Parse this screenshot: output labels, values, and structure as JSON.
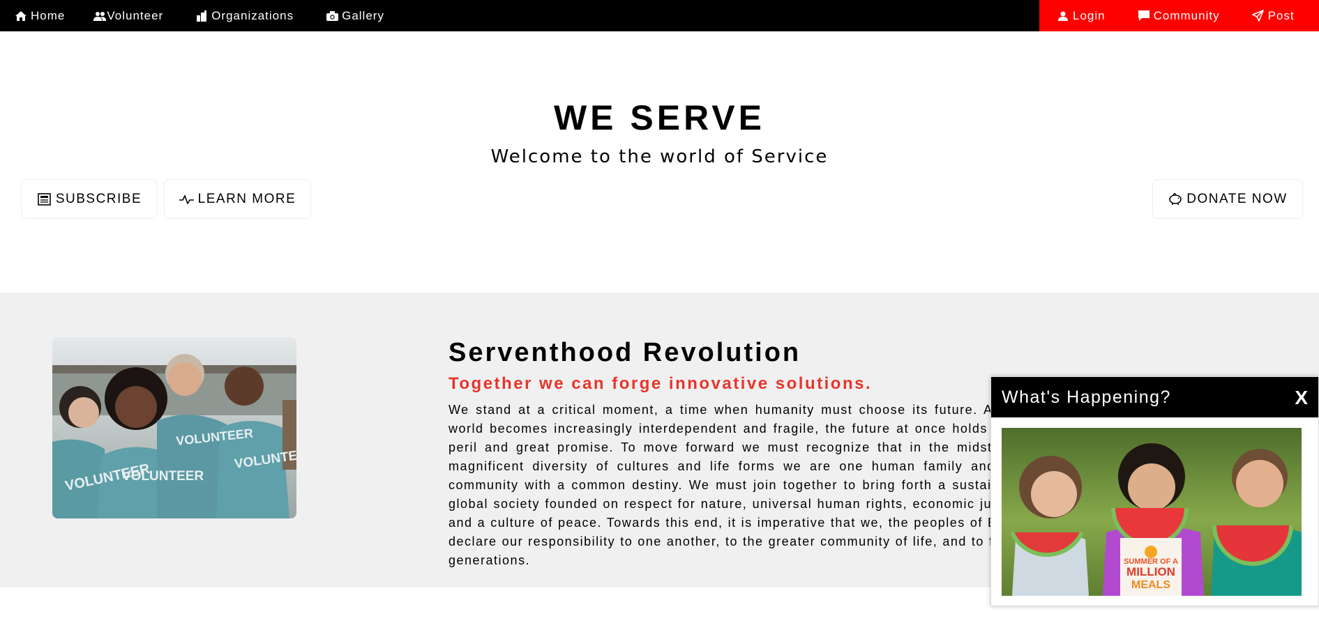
{
  "nav": {
    "left": [
      {
        "label": "Home",
        "icon": "home-icon"
      },
      {
        "label": "Volunteer",
        "icon": "users-icon"
      },
      {
        "label": "Organizations",
        "icon": "building-icon"
      },
      {
        "label": "Gallery",
        "icon": "camera-icon"
      }
    ],
    "right": [
      {
        "label": "Login",
        "icon": "user-icon"
      },
      {
        "label": "Community",
        "icon": "chat-icon"
      },
      {
        "label": "Post",
        "icon": "send-icon"
      }
    ],
    "accent": "#ff0000"
  },
  "hero": {
    "title": "WE SERVE",
    "subtitle": "Welcome to the world of Service",
    "subscribe": "SUBSCRIBE",
    "learn_more": "LEARN MORE",
    "donate": "DONATE NOW"
  },
  "section": {
    "title": "Serventhood Revolution",
    "subtitle": "Together we can forge innovative solutions.",
    "text": "We stand at a critical moment, a time when humanity must choose its future. As the world becomes increasingly interdependent and fragile, the future at once holds great peril and great promise. To move forward we must recognize that in the midst of a magnificent diversity of cultures and life forms we are one human family and one community with a common destiny. We must join together to bring forth a sustainable global society founded on respect for nature, universal human rights, economic justice, and a culture of peace. Towards this end, it is imperative that we, the peoples of Earth, declare our responsibility to one another, to the greater community of life, and to future generations.",
    "photo_shirt_text": "VOLUNTEER",
    "accent": "#e8342a"
  },
  "popup": {
    "title": "What's Happening?",
    "close": "X",
    "badge": [
      "SUMMER OF A",
      "MILLION",
      "MEALS"
    ]
  }
}
